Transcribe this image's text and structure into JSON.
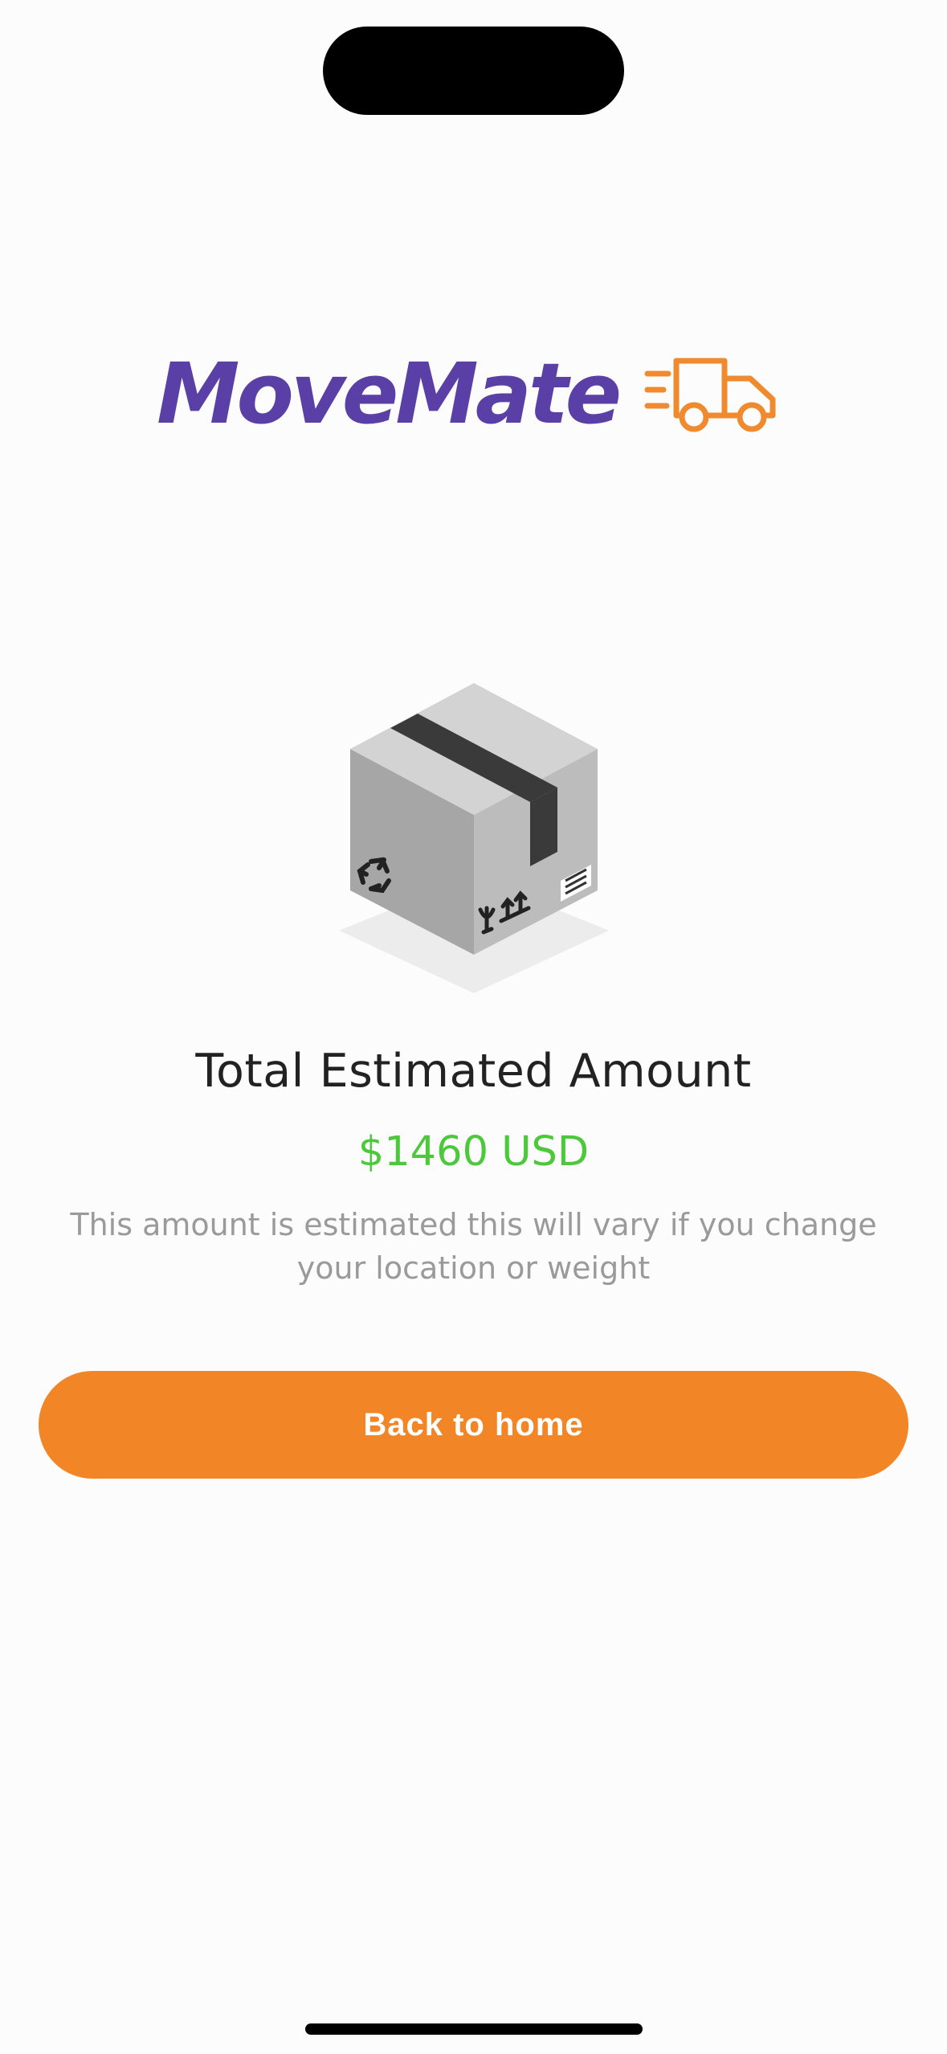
{
  "brand": {
    "name": "MoveMate",
    "primary_color": "#5a3fa6",
    "accent_color": "#f28627",
    "icon": "delivery-truck-icon"
  },
  "illustration": {
    "icon": "cardboard-box-icon"
  },
  "estimate": {
    "title": "Total Estimated Amount",
    "amount": "$1460 USD",
    "amount_color": "#4cc93a",
    "note": "This amount is estimated this will vary if you change your location or weight"
  },
  "actions": {
    "back_home_label": "Back to home"
  }
}
